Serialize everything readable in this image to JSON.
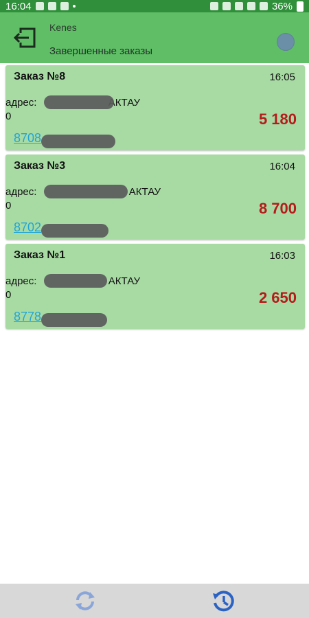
{
  "status_bar": {
    "time": "16:04",
    "battery": "36%"
  },
  "app_header": {
    "username": "Kenes",
    "subtitle": "Завершенные заказы"
  },
  "orders": [
    {
      "title": "Заказ №8",
      "time": "16:05",
      "address_label": "адрес:",
      "address_suffix": "АКТАУ",
      "zero": "0",
      "amount": "5 180",
      "phone": "8708"
    },
    {
      "title": "Заказ №3",
      "time": "16:04",
      "address_label": "адрес:",
      "address_suffix": "АКТАУ",
      "zero": "0",
      "amount": "8 700",
      "phone": "8702"
    },
    {
      "title": "Заказ №1",
      "time": "16:03",
      "address_label": "адрес:",
      "address_suffix": "АКТАУ",
      "zero": "0",
      "amount": "2 650",
      "phone": "8778"
    }
  ],
  "colors": {
    "header_green": "#5fbe66",
    "card_green": "#a8dba4",
    "amount_red": "#b51b1b",
    "phone_blue": "#21a5d8",
    "bottom_bar": "#d8d8d8"
  },
  "icons": {
    "logout": "logout-icon",
    "refresh": "refresh-icon",
    "history": "history-icon"
  }
}
